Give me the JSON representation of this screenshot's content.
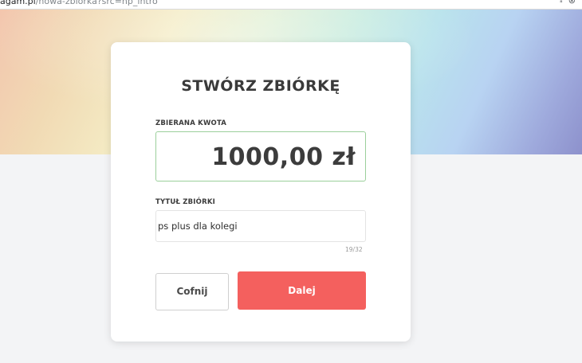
{
  "browser": {
    "url_host": "agam.pl",
    "url_path": "/nowa-zbiorka?src=hp_intro"
  },
  "form": {
    "title": "STWÓRZ ZBIÓRKĘ",
    "amount_label": "ZBIERANA KWOTA",
    "amount_value": "1000,00 zł",
    "title_label": "TYTUŁ ZBIÓRKI",
    "title_value": "ps plus dla kolegi",
    "char_counter": "19/32",
    "back_label": "Cofnij",
    "next_label": "Dalej"
  },
  "colors": {
    "primary_button": "#f4605e",
    "amount_border": "#9bcf9b"
  }
}
